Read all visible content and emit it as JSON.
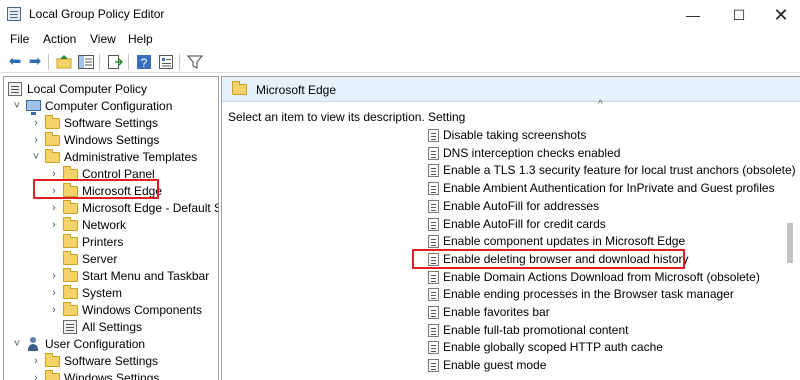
{
  "window": {
    "title": "Local Group Policy Editor",
    "minimize_glyph": "—",
    "maximize_glyph": "☐",
    "close_glyph": "✕"
  },
  "menu": [
    "File",
    "Action",
    "View",
    "Help"
  ],
  "toolbar_icons": [
    "back-icon",
    "forward-icon",
    "up-folder-icon",
    "show-hide-tree-icon",
    "export-list-icon",
    "help-icon",
    "properties-icon",
    "filter-icon"
  ],
  "tree": {
    "root": "Local Computer Policy",
    "items": [
      {
        "label": "Computer Configuration",
        "chev": "˅",
        "icon": "computer"
      },
      {
        "label": "Software Settings",
        "chev": "›",
        "icon": "folder"
      },
      {
        "label": "Windows Settings",
        "chev": "›",
        "icon": "folder"
      },
      {
        "label": "Administrative Templates",
        "chev": "˅",
        "icon": "folder"
      },
      {
        "label": "Control Panel",
        "chev": "›",
        "icon": "folder"
      },
      {
        "label": "Microsoft Edge",
        "chev": "›",
        "icon": "folder",
        "selected": true
      },
      {
        "label": "Microsoft Edge - Default Settings",
        "chev": "›",
        "icon": "folder"
      },
      {
        "label": "Network",
        "chev": "›",
        "icon": "folder"
      },
      {
        "label": "Printers",
        "chev": "",
        "icon": "folder"
      },
      {
        "label": "Server",
        "chev": "",
        "icon": "folder"
      },
      {
        "label": "Start Menu and Taskbar",
        "chev": "›",
        "icon": "folder"
      },
      {
        "label": "System",
        "chev": "›",
        "icon": "folder"
      },
      {
        "label": "Windows Components",
        "chev": "›",
        "icon": "folder"
      },
      {
        "label": "All Settings",
        "chev": "",
        "icon": "gpo"
      },
      {
        "label": "User Configuration",
        "chev": "˅",
        "icon": "user"
      },
      {
        "label": "Software Settings",
        "chev": "›",
        "icon": "folder"
      },
      {
        "label": "Windows Settings",
        "chev": "›",
        "icon": "folder"
      }
    ]
  },
  "right_pane": {
    "title": "Microsoft Edge",
    "description": "Select an item to view its description.",
    "column_header": "Setting",
    "sort_glyph": "^",
    "settings": [
      "Disable taking screenshots",
      "DNS interception checks enabled",
      "Enable a TLS 1.3 security feature for local trust anchors (obsolete)",
      "Enable Ambient Authentication for InPrivate and Guest profiles",
      "Enable AutoFill for addresses",
      "Enable AutoFill for credit cards",
      "Enable component updates in Microsoft Edge",
      "Enable deleting browser and download history",
      "Enable Domain Actions Download from Microsoft (obsolete)",
      "Enable ending processes in the Browser task manager",
      "Enable favorites bar",
      "Enable full-tab promotional content",
      "Enable globally scoped HTTP auth cache",
      "Enable guest mode"
    ],
    "highlighted_setting": "Enable deleting browser and download history"
  },
  "colors": {
    "highlight_border": "#e02020",
    "header_bg": "#e6f0fa",
    "folder": "#f5d36a"
  }
}
